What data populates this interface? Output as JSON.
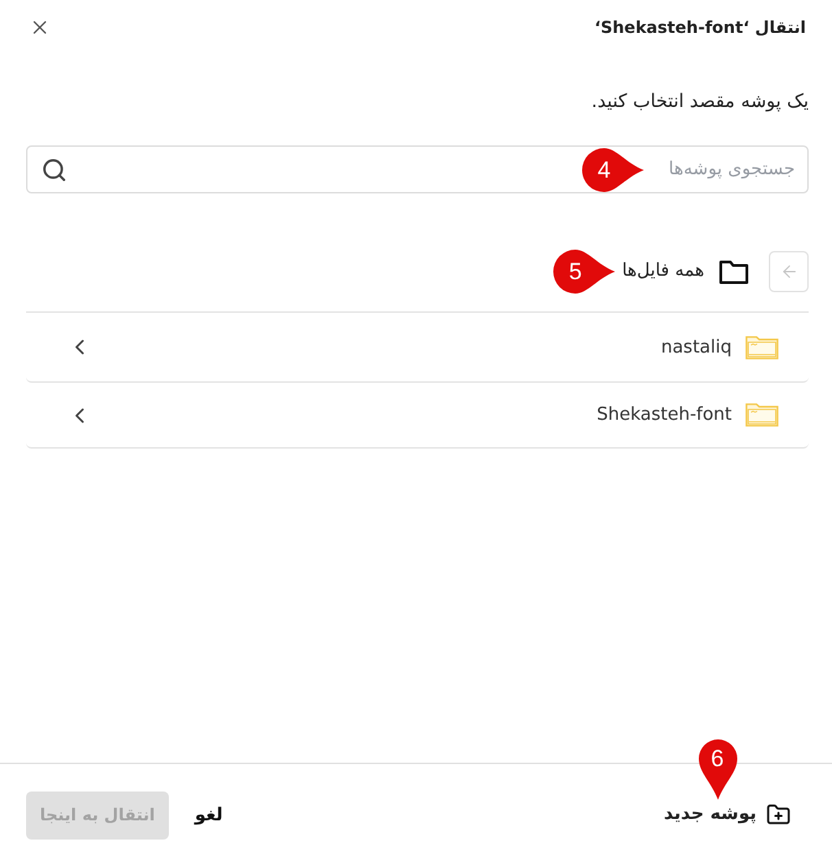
{
  "dialog": {
    "title": "انتقال ‘Shekasteh-font‘",
    "prompt": "یک پوشه مقصد انتخاب کنید."
  },
  "search": {
    "placeholder": "جستجوی پوشه‌ها",
    "callout": {
      "number": "4",
      "kind": "sideways"
    }
  },
  "breadcrumb": {
    "label": "همه فایل‌ها",
    "back_disabled": true,
    "callout": {
      "number": "5",
      "kind": "sideways"
    }
  },
  "folders": [
    {
      "name": "nastaliq"
    },
    {
      "name": "Shekasteh-font"
    }
  ],
  "footer": {
    "new_folder": {
      "label": "پوشه جدید",
      "callout": {
        "number": "6",
        "kind": "pin"
      }
    },
    "cancel": "لغو",
    "move": {
      "label": "انتقال به اینجا",
      "disabled": true
    }
  }
}
